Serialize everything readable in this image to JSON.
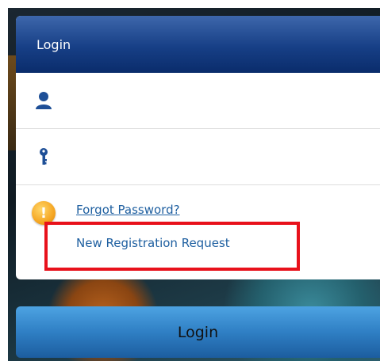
{
  "panel": {
    "title": "Login"
  },
  "fields": {
    "username": {
      "icon": "user-icon",
      "value": "",
      "placeholder": ""
    },
    "password": {
      "icon": "key-icon",
      "value": "",
      "placeholder": ""
    }
  },
  "links": {
    "warning_icon": "warning-icon",
    "forgot_password": "Forgot Password?",
    "new_registration": "New Registration Request"
  },
  "login_button": {
    "label": "Login"
  },
  "colors": {
    "header": "#173f86",
    "link": "#1e5fa0",
    "button": "#2f7fc4",
    "highlight": "#e8111b"
  }
}
